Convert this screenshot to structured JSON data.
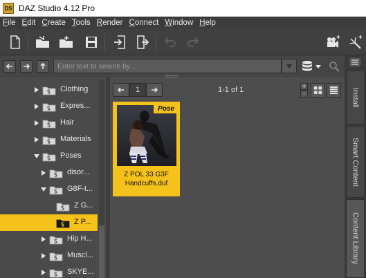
{
  "window": {
    "title": "DAZ Studio 4.12 Pro",
    "app_icon": "DS"
  },
  "menu": [
    {
      "label": "File",
      "u": "F",
      "rest": "ile"
    },
    {
      "label": "Edit",
      "u": "E",
      "rest": "dit"
    },
    {
      "label": "Create",
      "u": "C",
      "rest": "reate"
    },
    {
      "label": "Tools",
      "u": "T",
      "rest": "ools"
    },
    {
      "label": "Render",
      "u": "R",
      "rest": "ender"
    },
    {
      "label": "Connect",
      "u": "C",
      "rest": "onnect"
    },
    {
      "label": "Window",
      "u": "W",
      "rest": "indow"
    },
    {
      "label": "Help",
      "u": "H",
      "rest": "elp"
    }
  ],
  "search": {
    "placeholder": "Enter text to search by..."
  },
  "tree": {
    "items": [
      {
        "label": "Clothing",
        "expanded": false
      },
      {
        "label": "Expres...",
        "expanded": false
      },
      {
        "label": "Hair",
        "expanded": false
      },
      {
        "label": "Materials",
        "expanded": false
      },
      {
        "label": "Poses",
        "expanded": true
      },
      {
        "label": "disor...",
        "expanded": false
      },
      {
        "label": "G8F-t...",
        "expanded": true
      },
      {
        "label": "Z G...",
        "expanded": null
      },
      {
        "label": "Z P...",
        "expanded": null,
        "selected": true
      },
      {
        "label": "Hip H...",
        "expanded": false
      },
      {
        "label": "Muscl...",
        "expanded": false
      },
      {
        "label": "SKYE...",
        "expanded": false
      }
    ]
  },
  "content": {
    "page": "1",
    "result_count": "1-1 of 1",
    "zoom_plus": "+",
    "zoom_minus": "-",
    "asset": {
      "badge": "Pose",
      "name_line1": "Z POL 33 G3F",
      "name_line2": "Handcuffs.duf"
    }
  },
  "side_tabs": [
    "Install",
    "Smart Content",
    "Content Library"
  ],
  "colors": {
    "accent": "#f4c21a",
    "panel": "#4a4a4a",
    "menubar": "#3c3c3c"
  }
}
